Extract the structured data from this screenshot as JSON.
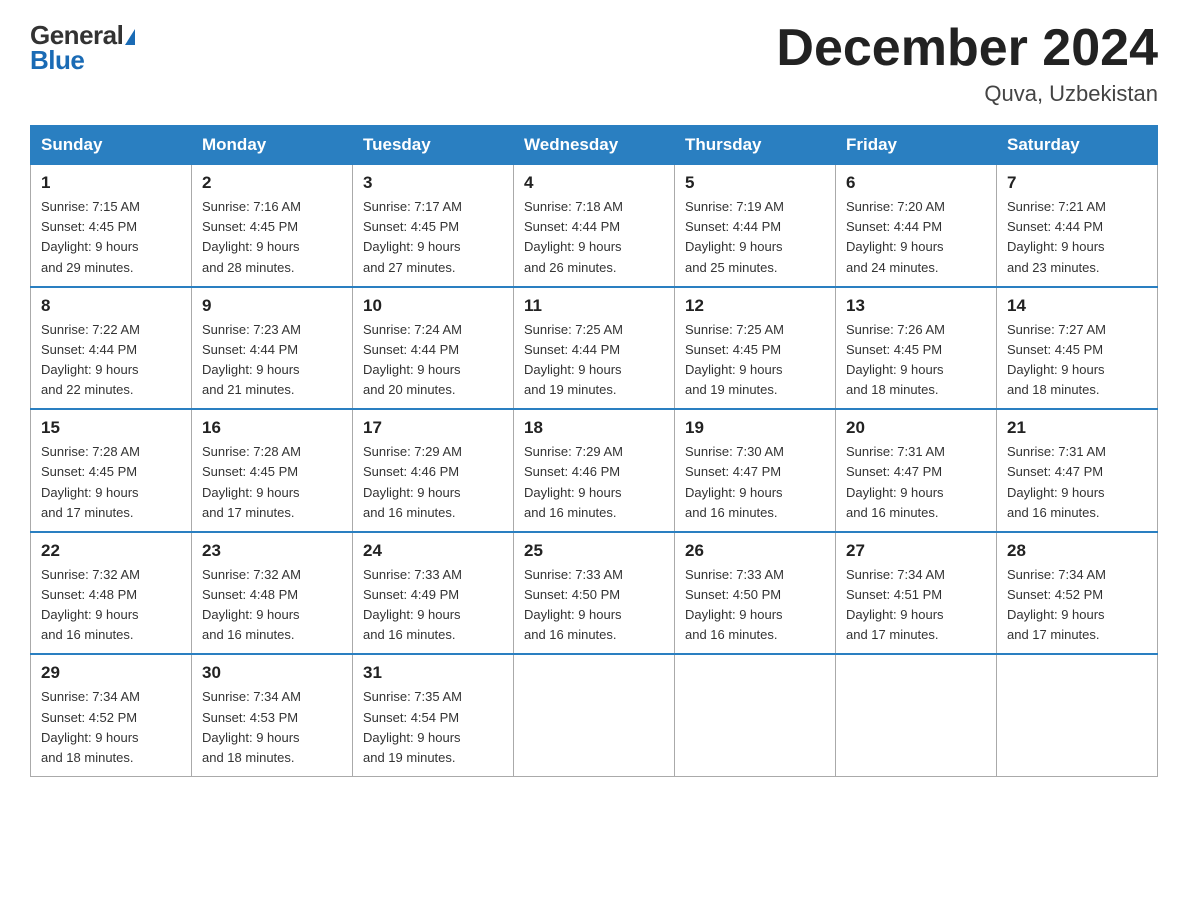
{
  "header": {
    "logo_general": "General",
    "logo_blue": "Blue",
    "month_title": "December 2024",
    "location": "Quva, Uzbekistan"
  },
  "weekdays": [
    "Sunday",
    "Monday",
    "Tuesday",
    "Wednesday",
    "Thursday",
    "Friday",
    "Saturday"
  ],
  "weeks": [
    [
      {
        "day": "1",
        "sunrise": "7:15 AM",
        "sunset": "4:45 PM",
        "daylight": "9 hours and 29 minutes."
      },
      {
        "day": "2",
        "sunrise": "7:16 AM",
        "sunset": "4:45 PM",
        "daylight": "9 hours and 28 minutes."
      },
      {
        "day": "3",
        "sunrise": "7:17 AM",
        "sunset": "4:45 PM",
        "daylight": "9 hours and 27 minutes."
      },
      {
        "day": "4",
        "sunrise": "7:18 AM",
        "sunset": "4:44 PM",
        "daylight": "9 hours and 26 minutes."
      },
      {
        "day": "5",
        "sunrise": "7:19 AM",
        "sunset": "4:44 PM",
        "daylight": "9 hours and 25 minutes."
      },
      {
        "day": "6",
        "sunrise": "7:20 AM",
        "sunset": "4:44 PM",
        "daylight": "9 hours and 24 minutes."
      },
      {
        "day": "7",
        "sunrise": "7:21 AM",
        "sunset": "4:44 PM",
        "daylight": "9 hours and 23 minutes."
      }
    ],
    [
      {
        "day": "8",
        "sunrise": "7:22 AM",
        "sunset": "4:44 PM",
        "daylight": "9 hours and 22 minutes."
      },
      {
        "day": "9",
        "sunrise": "7:23 AM",
        "sunset": "4:44 PM",
        "daylight": "9 hours and 21 minutes."
      },
      {
        "day": "10",
        "sunrise": "7:24 AM",
        "sunset": "4:44 PM",
        "daylight": "9 hours and 20 minutes."
      },
      {
        "day": "11",
        "sunrise": "7:25 AM",
        "sunset": "4:44 PM",
        "daylight": "9 hours and 19 minutes."
      },
      {
        "day": "12",
        "sunrise": "7:25 AM",
        "sunset": "4:45 PM",
        "daylight": "9 hours and 19 minutes."
      },
      {
        "day": "13",
        "sunrise": "7:26 AM",
        "sunset": "4:45 PM",
        "daylight": "9 hours and 18 minutes."
      },
      {
        "day": "14",
        "sunrise": "7:27 AM",
        "sunset": "4:45 PM",
        "daylight": "9 hours and 18 minutes."
      }
    ],
    [
      {
        "day": "15",
        "sunrise": "7:28 AM",
        "sunset": "4:45 PM",
        "daylight": "9 hours and 17 minutes."
      },
      {
        "day": "16",
        "sunrise": "7:28 AM",
        "sunset": "4:45 PM",
        "daylight": "9 hours and 17 minutes."
      },
      {
        "day": "17",
        "sunrise": "7:29 AM",
        "sunset": "4:46 PM",
        "daylight": "9 hours and 16 minutes."
      },
      {
        "day": "18",
        "sunrise": "7:29 AM",
        "sunset": "4:46 PM",
        "daylight": "9 hours and 16 minutes."
      },
      {
        "day": "19",
        "sunrise": "7:30 AM",
        "sunset": "4:47 PM",
        "daylight": "9 hours and 16 minutes."
      },
      {
        "day": "20",
        "sunrise": "7:31 AM",
        "sunset": "4:47 PM",
        "daylight": "9 hours and 16 minutes."
      },
      {
        "day": "21",
        "sunrise": "7:31 AM",
        "sunset": "4:47 PM",
        "daylight": "9 hours and 16 minutes."
      }
    ],
    [
      {
        "day": "22",
        "sunrise": "7:32 AM",
        "sunset": "4:48 PM",
        "daylight": "9 hours and 16 minutes."
      },
      {
        "day": "23",
        "sunrise": "7:32 AM",
        "sunset": "4:48 PM",
        "daylight": "9 hours and 16 minutes."
      },
      {
        "day": "24",
        "sunrise": "7:33 AM",
        "sunset": "4:49 PM",
        "daylight": "9 hours and 16 minutes."
      },
      {
        "day": "25",
        "sunrise": "7:33 AM",
        "sunset": "4:50 PM",
        "daylight": "9 hours and 16 minutes."
      },
      {
        "day": "26",
        "sunrise": "7:33 AM",
        "sunset": "4:50 PM",
        "daylight": "9 hours and 16 minutes."
      },
      {
        "day": "27",
        "sunrise": "7:34 AM",
        "sunset": "4:51 PM",
        "daylight": "9 hours and 17 minutes."
      },
      {
        "day": "28",
        "sunrise": "7:34 AM",
        "sunset": "4:52 PM",
        "daylight": "9 hours and 17 minutes."
      }
    ],
    [
      {
        "day": "29",
        "sunrise": "7:34 AM",
        "sunset": "4:52 PM",
        "daylight": "9 hours and 18 minutes."
      },
      {
        "day": "30",
        "sunrise": "7:34 AM",
        "sunset": "4:53 PM",
        "daylight": "9 hours and 18 minutes."
      },
      {
        "day": "31",
        "sunrise": "7:35 AM",
        "sunset": "4:54 PM",
        "daylight": "9 hours and 19 minutes."
      },
      null,
      null,
      null,
      null
    ]
  ],
  "labels": {
    "sunrise": "Sunrise:",
    "sunset": "Sunset:",
    "daylight": "Daylight:"
  }
}
